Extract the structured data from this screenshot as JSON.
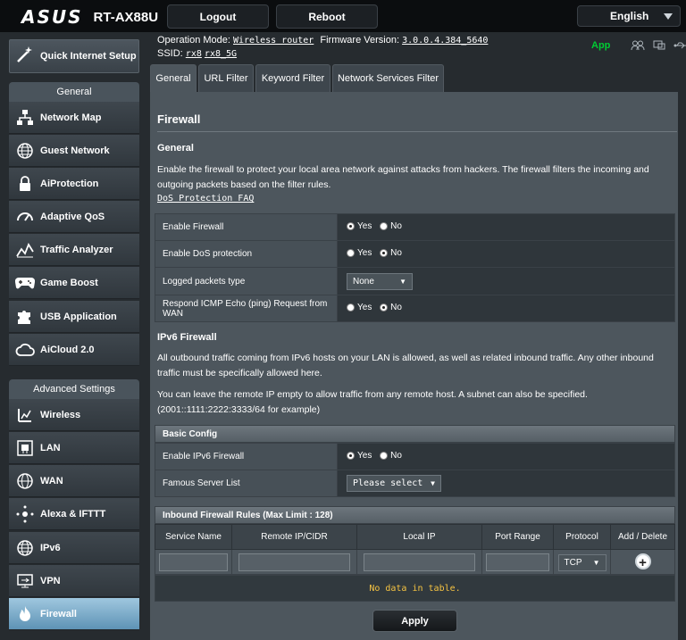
{
  "header": {
    "logo_text": "ASUS",
    "model": "RT-AX88U",
    "logout_label": "Logout",
    "reboot_label": "Reboot",
    "language": "English"
  },
  "status": {
    "op_mode_label": "Operation Mode:",
    "op_mode_value": "Wireless router",
    "fw_label": "Firmware Version:",
    "fw_value": "3.0.0.4.384_5640",
    "ssid_label": "SSID:",
    "ssid_1": "rx8",
    "ssid_2": "rx8_5G",
    "app_label": "App",
    "icons": [
      "users-icon",
      "monitor-icon",
      "usb-icon"
    ]
  },
  "sidebar": {
    "qis_label": "Quick Internet Setup",
    "general_header": "General",
    "general_items": [
      {
        "label": "Network Map",
        "icon": "network-map-icon"
      },
      {
        "label": "Guest Network",
        "icon": "globe-icon"
      },
      {
        "label": "AiProtection",
        "icon": "lock-icon"
      },
      {
        "label": "Adaptive QoS",
        "icon": "gauge-icon"
      },
      {
        "label": "Traffic Analyzer",
        "icon": "chart-icon"
      },
      {
        "label": "Game Boost",
        "icon": "gamepad-icon"
      },
      {
        "label": "USB Application",
        "icon": "puzzle-icon"
      },
      {
        "label": "AiCloud 2.0",
        "icon": "cloud-icon"
      }
    ],
    "advanced_header": "Advanced Settings",
    "advanced_items": [
      {
        "label": "Wireless",
        "icon": "wifi-icon"
      },
      {
        "label": "LAN",
        "icon": "lan-icon"
      },
      {
        "label": "WAN",
        "icon": "wan-globe-icon"
      },
      {
        "label": "Alexa & IFTTT",
        "icon": "alexa-icon"
      },
      {
        "label": "IPv6",
        "icon": "ipv6-globe-icon"
      },
      {
        "label": "VPN",
        "icon": "vpn-icon"
      },
      {
        "label": "Firewall",
        "icon": "fire-icon"
      }
    ]
  },
  "tabs": [
    "General",
    "URL Filter",
    "Keyword Filter",
    "Network Services Filter"
  ],
  "main": {
    "title": "Firewall",
    "general_heading": "General",
    "general_desc": "Enable the firewall to protect your local area network against attacks from hackers. The firewall filters the incoming and outgoing packets based on the filter rules.",
    "faq_link": "DoS Protection FAQ",
    "rows": [
      {
        "label": "Enable Firewall",
        "yes": "Yes",
        "no": "No",
        "selected": "yes"
      },
      {
        "label": "Enable DoS protection",
        "yes": "Yes",
        "no": "No",
        "selected": "no"
      },
      {
        "label": "Logged packets type",
        "select": "None"
      },
      {
        "label": "Respond ICMP Echo (ping) Request from WAN",
        "yes": "Yes",
        "no": "No",
        "selected": "no"
      }
    ],
    "ipv6_heading": "IPv6 Firewall",
    "ipv6_desc1": "All outbound traffic coming from IPv6 hosts on your LAN is allowed, as well as related inbound traffic. Any other inbound traffic must be specifically allowed here.",
    "ipv6_desc2": "You can leave the remote IP empty to allow traffic from any remote host. A subnet can also be specified. (2001::1111:2222:3333/64 for example)",
    "basic_config": "Basic Config",
    "enable_ipv6_label": "Enable IPv6 Firewall",
    "enable_ipv6_yes": "Yes",
    "enable_ipv6_no": "No",
    "famous_label": "Famous Server List",
    "famous_select": "Please select",
    "rules_header": "Inbound Firewall Rules (Max Limit : 128)",
    "columns": [
      "Service Name",
      "Remote IP/CIDR",
      "Local IP",
      "Port Range",
      "Protocol",
      "Add / Delete"
    ],
    "protocol_value": "TCP",
    "no_data": "No data in table.",
    "apply_label": "Apply"
  },
  "colors": {
    "background": "#262b2f",
    "panel": "#4d565d",
    "active_nav": "#5e93b5",
    "app_green": "#00cc33",
    "no_data_yellow": "#f5c342"
  }
}
